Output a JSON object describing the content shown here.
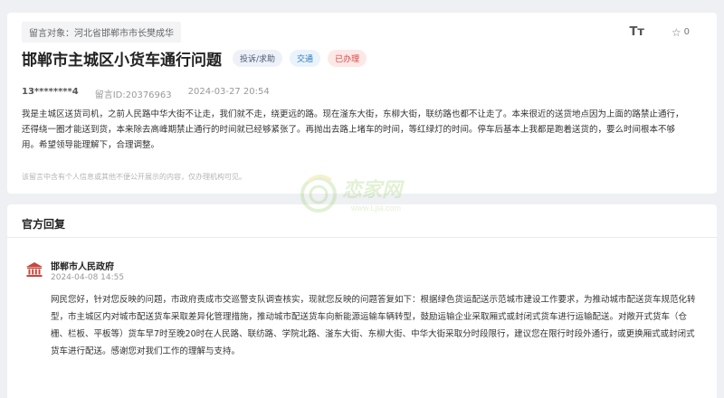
{
  "message": {
    "recipient": "留言对象：河北省邯郸市市长樊成华",
    "title": "邯郸市主城区小货车通行问题",
    "tags": {
      "type": "投诉/求助",
      "field": "交通",
      "status": "已办理"
    },
    "user": "13********4",
    "message_id": "留言ID:20376963",
    "timestamp": "2024-03-27 20:54",
    "content": "我是主城区送货司机，之前人民路中华大街不让走，我们就不走，绕更远的路。现在滏东大街，东柳大街，联纺路也都不让走了。本来很近的送货地点因为上面的路禁止通行，还得绕一圈才能送到货，本来除去高峰期禁止通行的时间就已经够紧张了。再抛出去路上堵车的时间，等红绿灯的时间。停车后基本上我都是跑着送货的，要么时间根本不够用。希望领导能理解下，合理调整。",
    "privacy_note": "该留言中含有个人信息或其他不便公开展示的内容，仅办理机构可见。"
  },
  "toolbar": {
    "font_size_label": "Tт",
    "favorite_count": "0",
    "font_size_icon": "font-size-icon",
    "favorite_icon": "star-icon"
  },
  "watermark": {
    "brand": "恋家网",
    "url": "www.Ljia.com"
  },
  "reply": {
    "section_title": "官方回复",
    "org_name": "邯郸市人民政府",
    "org_icon": "government-building-icon",
    "date": "2024-04-08 14:55",
    "content": "网民您好，针对您反映的问题，市政府责成市交巡警支队调查核实，现就您反映的问题答复如下：根据绿色货运配送示范城市建设工作要求，为推动城市配送货车规范化转型，市主城区内对城市配送货车采取差异化管理措施，推动城市配送货车向新能源运输车辆转型，鼓励运输企业采取厢式或封闭式货车进行运输配送。对敞开式货车（仓栅、栏板、平板等）货车早7时至晚20时在人民路、联纺路、学院北路、滏东大街、东柳大街、中华大街采取分时段限行，建议您在限行时段外通行，或更换厢式或封闭式货车进行配送。感谢您对我们工作的理解与支持。"
  },
  "colors": {
    "status_red": "#d8453e",
    "field_blue": "#2b7bbd",
    "background": "#eef0f3"
  }
}
